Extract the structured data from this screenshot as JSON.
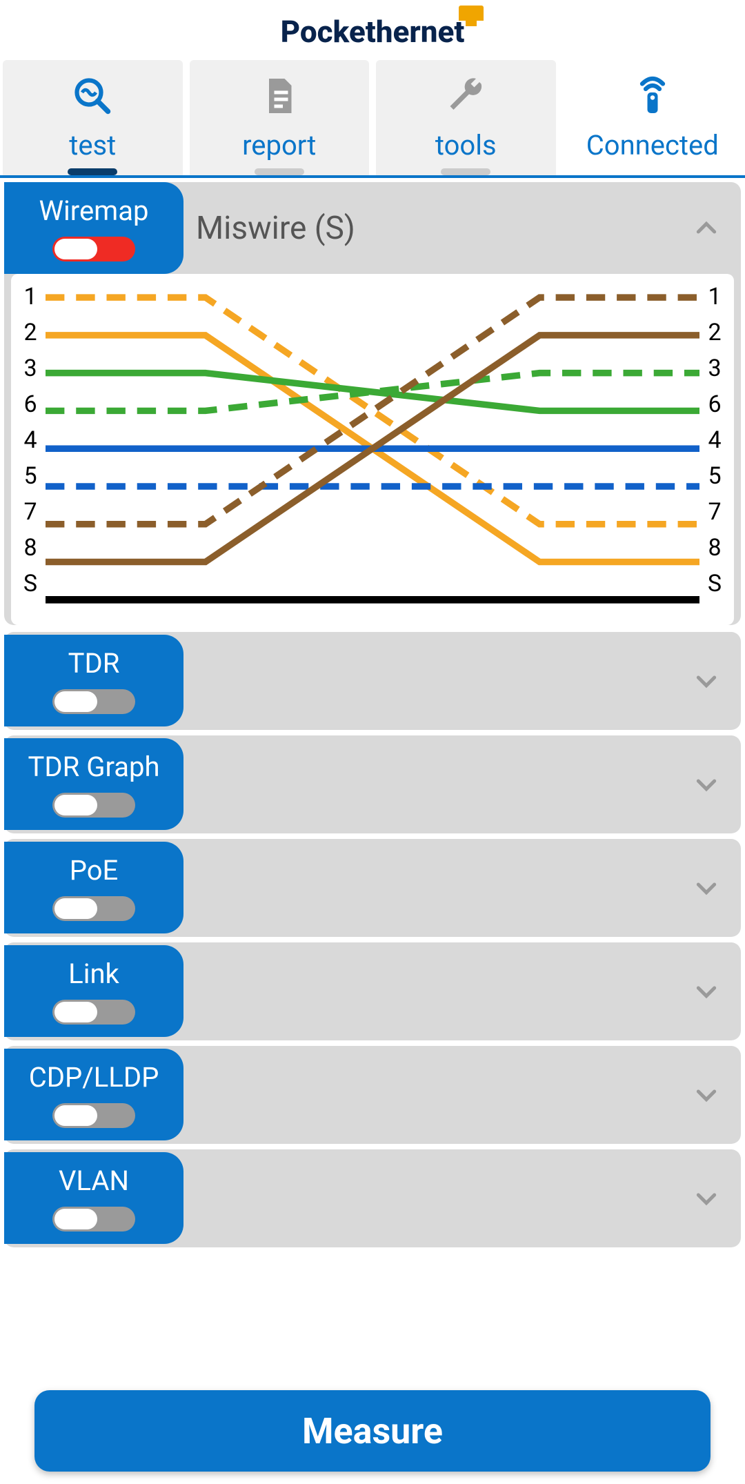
{
  "brand": "Pockethernet",
  "tabs": {
    "test": "test",
    "report": "report",
    "tools": "tools",
    "connected": "Connected"
  },
  "wiremap": {
    "label": "Wiremap",
    "status": "Miswire (S)",
    "left_pins": [
      "1",
      "2",
      "3",
      "6",
      "4",
      "5",
      "7",
      "8",
      "S"
    ],
    "right_pins": [
      "1",
      "2",
      "3",
      "6",
      "4",
      "5",
      "7",
      "8",
      "S"
    ]
  },
  "panels": {
    "tdr": "TDR",
    "tdr_graph": "TDR Graph",
    "poe": "PoE",
    "link": "Link",
    "cdp_lldp": "CDP/LLDP",
    "vlan": "VLAN"
  },
  "measure": "Measure",
  "chart_data": {
    "type": "wiremap",
    "title": "Miswire (S)",
    "pins_left": [
      "1",
      "2",
      "3",
      "6",
      "4",
      "5",
      "7",
      "8",
      "S"
    ],
    "pins_right": [
      "1",
      "2",
      "3",
      "6",
      "4",
      "5",
      "7",
      "8",
      "S"
    ],
    "connections": [
      {
        "from": "1",
        "to": "7",
        "color": "#F5A623",
        "style": "dashed"
      },
      {
        "from": "2",
        "to": "8",
        "color": "#F5A623",
        "style": "solid"
      },
      {
        "from": "3",
        "to": "6",
        "color": "#3BA935",
        "style": "solid"
      },
      {
        "from": "6",
        "to": "3",
        "color": "#3BA935",
        "style": "dashed"
      },
      {
        "from": "4",
        "to": "4",
        "color": "#1161C9",
        "style": "solid"
      },
      {
        "from": "5",
        "to": "5",
        "color": "#1161C9",
        "style": "dashed"
      },
      {
        "from": "7",
        "to": "1",
        "color": "#8B5E2B",
        "style": "dashed"
      },
      {
        "from": "8",
        "to": "2",
        "color": "#8B5E2B",
        "style": "solid"
      },
      {
        "from": "S",
        "to": "S",
        "color": "#000000",
        "style": "solid"
      }
    ]
  }
}
